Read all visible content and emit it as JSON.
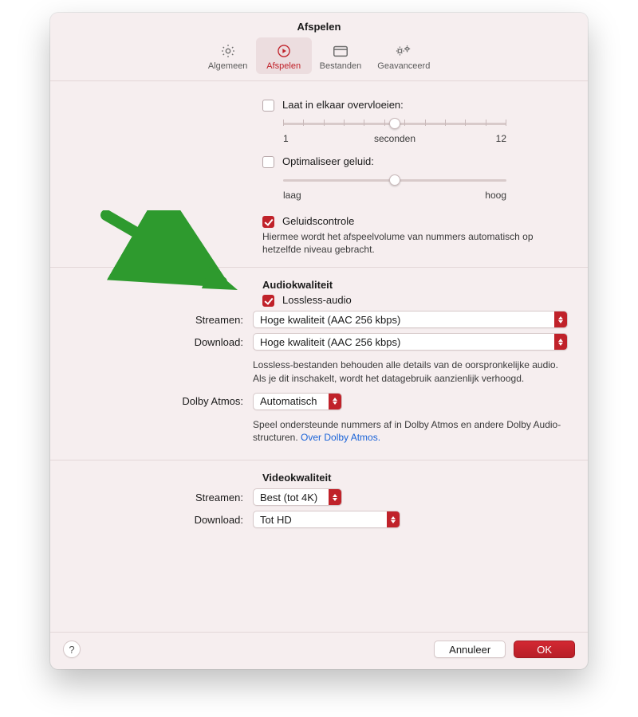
{
  "window": {
    "title": "Afspelen"
  },
  "toolbar": {
    "items": [
      {
        "label": "Algemeen"
      },
      {
        "label": "Afspelen"
      },
      {
        "label": "Bestanden"
      },
      {
        "label": "Geavanceerd"
      }
    ]
  },
  "playback": {
    "crossfade_label": "Laat in elkaar overvloeien:",
    "crossfade_min": "1",
    "crossfade_unit": "seconden",
    "crossfade_max": "12",
    "eq_label": "Optimaliseer geluid:",
    "eq_low": "laag",
    "eq_high": "hoog",
    "soundcheck_label": "Geluidscontrole",
    "soundcheck_desc": "Hiermee wordt het afspeelvolume van nummers automatisch op hetzelfde niveau gebracht."
  },
  "audio": {
    "heading": "Audiokwaliteit",
    "lossless_label": "Lossless-audio",
    "stream_label": "Streamen:",
    "stream_value": "Hoge kwaliteit (AAC 256 kbps)",
    "download_label": "Download:",
    "download_value": "Hoge kwaliteit (AAC 256 kbps)",
    "lossless_desc": "Lossless-bestanden behouden alle details van de oorspronkelijke audio. Als je dit inschakelt, wordt het datagebruik aanzienlijk verhoogd.",
    "dolby_label": "Dolby Atmos:",
    "dolby_value": "Automatisch",
    "dolby_desc_pre": "Speel ondersteunde nummers af in Dolby Atmos en andere Dolby Audio-structuren. ",
    "dolby_link": "Over Dolby Atmos."
  },
  "video": {
    "heading": "Videokwaliteit",
    "stream_label": "Streamen:",
    "stream_value": "Best (tot 4K)",
    "download_label": "Download:",
    "download_value": "Tot HD"
  },
  "footer": {
    "help": "?",
    "cancel": "Annuleer",
    "ok": "OK"
  }
}
